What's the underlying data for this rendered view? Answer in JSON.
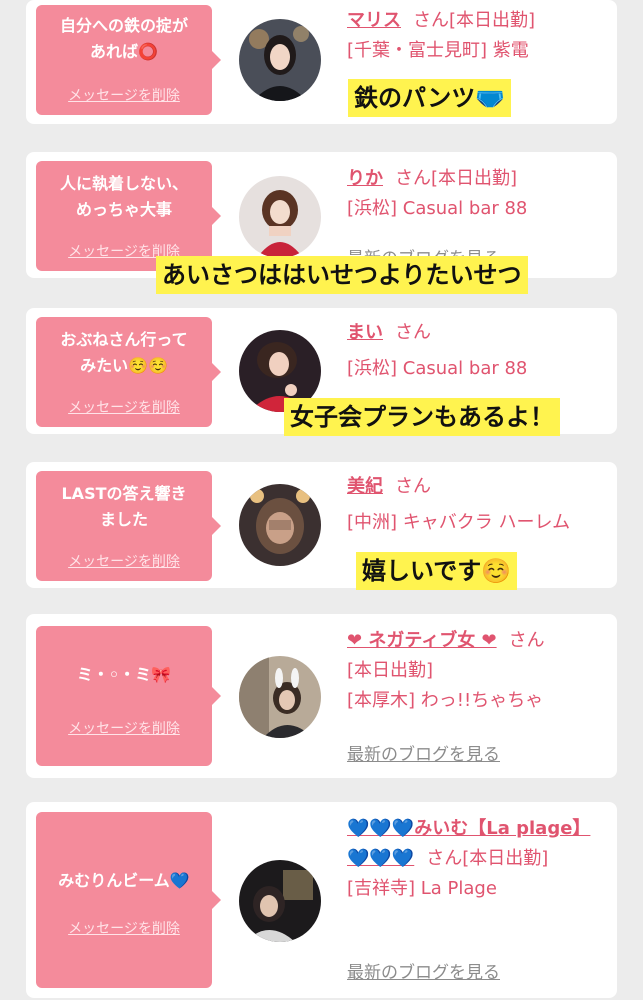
{
  "delete_label": "メッセージを削除",
  "blog_label": "最新のブログを見る",
  "san_label": "さん",
  "cards": [
    {
      "message": "自分への鉄の掟が\nあれば⭕",
      "name": "マリス",
      "lines": [
        "[本日出勤]",
        "[千葉・富士見町] 紫電"
      ],
      "caption": "鉄のパンツ🩲"
    },
    {
      "message": "人に執着しない、\nめっちゃ大事",
      "name": "りか",
      "lines": [
        "[本日出勤]",
        "[浜松] Casual bar 88"
      ],
      "caption": "あいさつははいせつよりたいせつ"
    },
    {
      "message": "おぶねさん行って\nみたい☺️☺️",
      "name": "まい",
      "lines": [
        "",
        "[浜松] Casual bar 88"
      ],
      "caption": "女子会プランもあるよ！"
    },
    {
      "message": "LASTの答え響き\nました",
      "name": "美紀",
      "lines": [
        "",
        "[中洲] キャバクラ ハーレム"
      ],
      "caption": "嬉しいです☺️"
    },
    {
      "message": "ミ・◦・ミ🎀",
      "name": "❤ ネガティブ女 ❤",
      "lines": [
        "[本日出勤]",
        "[本厚木] わっ!!ちゃちゃ"
      ],
      "caption": ""
    },
    {
      "message": "みむりんビーム💙",
      "name": "💙💙💙みいむ【La plage】💙💙💙",
      "lines": [
        "[本日出勤]",
        "[吉祥寺] La Plage"
      ],
      "caption": ""
    }
  ],
  "colors": {
    "bubble": "#f48b9b",
    "name": "#e0546f",
    "caption": "#fff34f"
  }
}
